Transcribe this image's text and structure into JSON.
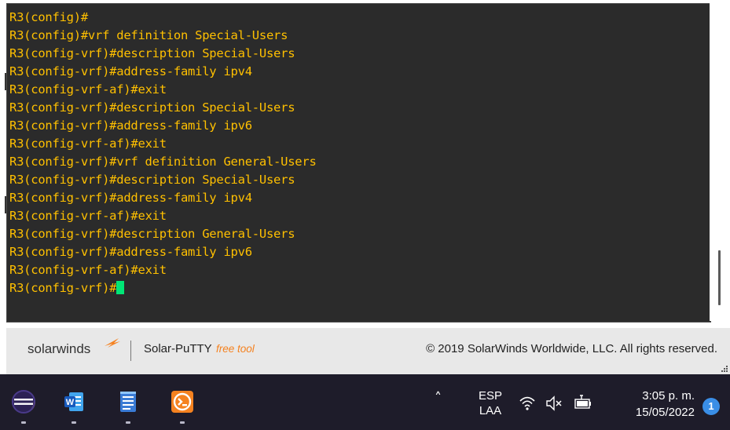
{
  "terminal": {
    "lines": [
      {
        "prompt": "R3(config)#",
        "cmd": ""
      },
      {
        "prompt": "R3(config)#",
        "cmd": "vrf definition Special-Users"
      },
      {
        "prompt": "R3(config-vrf)#",
        "cmd": "description Special-Users"
      },
      {
        "prompt": "R3(config-vrf)#",
        "cmd": "address-family ipv4"
      },
      {
        "prompt": "R3(config-vrf-af)#",
        "cmd": "exit"
      },
      {
        "prompt": "R3(config-vrf)#",
        "cmd": "description Special-Users"
      },
      {
        "prompt": "R3(config-vrf)#",
        "cmd": "address-family ipv6"
      },
      {
        "prompt": "R3(config-vrf-af)#",
        "cmd": "exit"
      },
      {
        "prompt": "R3(config-vrf)#",
        "cmd": "vrf definition General-Users"
      },
      {
        "prompt": "R3(config-vrf)#",
        "cmd": "description Special-Users"
      },
      {
        "prompt": "R3(config-vrf)#",
        "cmd": "address-family ipv4"
      },
      {
        "prompt": "R3(config-vrf-af)#",
        "cmd": "exit"
      },
      {
        "prompt": "R3(config-vrf)#",
        "cmd": "description General-Users"
      },
      {
        "prompt": "R3(config-vrf)#",
        "cmd": "address-family ipv6"
      },
      {
        "prompt": "R3(config-vrf-af)#",
        "cmd": "exit"
      },
      {
        "prompt": "R3(config-vrf)#",
        "cmd": ""
      }
    ],
    "colors": {
      "background": "#2b2b2b",
      "text": "#ffc000",
      "cursor": "#00e676"
    }
  },
  "footer": {
    "brand": "solarwinds",
    "product": "Solar-PuTTY",
    "product_tag": "free tool",
    "copyright": "© 2019 SolarWinds Worldwide, LLC. All rights reserved."
  },
  "taskbar": {
    "apps": [
      {
        "name": "eclipse-app-icon"
      },
      {
        "name": "word-app-icon"
      },
      {
        "name": "notepad-app-icon"
      },
      {
        "name": "solar-putty-app-icon"
      }
    ],
    "language": {
      "line1": "ESP",
      "line2": "LAA"
    },
    "clock": {
      "time": "3:05 p. m.",
      "date": "15/05/2022"
    },
    "notification_count": "1"
  }
}
